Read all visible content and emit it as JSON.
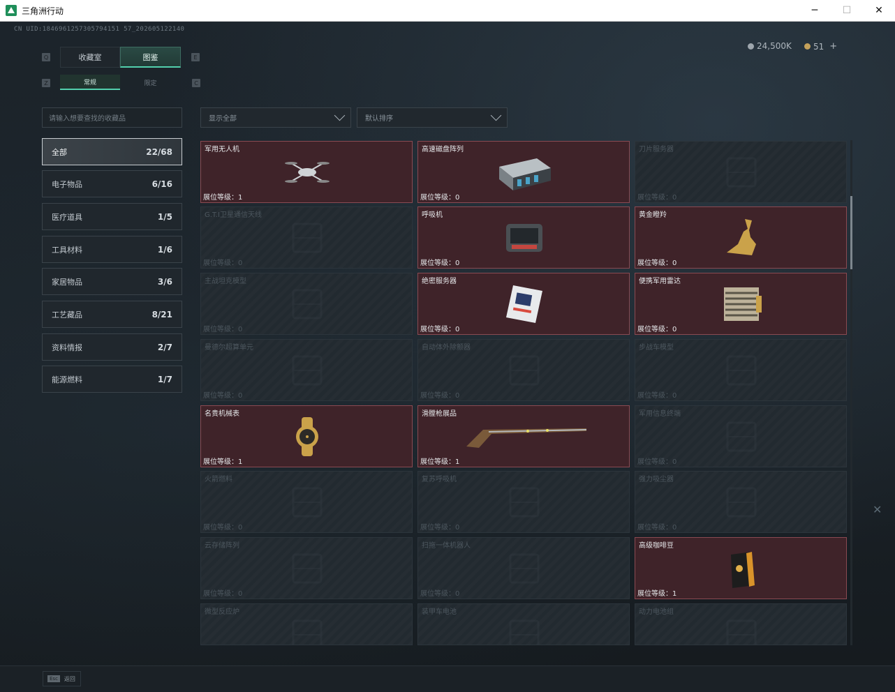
{
  "window": {
    "title": "三角洲行动",
    "minimize": "─",
    "maximize": "☐",
    "close": "✕"
  },
  "header": {
    "uid": "CN UID:1846961257305794151 57_202605122140",
    "currency1": "24,500K",
    "currency2": "51",
    "plus": "+"
  },
  "tabs": {
    "main": [
      {
        "label": "收藏室"
      },
      {
        "label": "图鉴"
      }
    ],
    "sub": [
      {
        "label": "常规"
      },
      {
        "label": "限定"
      }
    ],
    "key_q": "Q",
    "key_e": "E",
    "key_z": "Z",
    "key_c": "C"
  },
  "search": {
    "placeholder": "请输入想要查找的收藏品"
  },
  "filters": {
    "show": "显示全部",
    "sort": "默认排序"
  },
  "categories": [
    {
      "label": "全部",
      "count": "22/68"
    },
    {
      "label": "电子物品",
      "count": "6/16"
    },
    {
      "label": "医疗道具",
      "count": "1/5"
    },
    {
      "label": "工具材料",
      "count": "1/6"
    },
    {
      "label": "家居物品",
      "count": "3/6"
    },
    {
      "label": "工艺藏品",
      "count": "8/21"
    },
    {
      "label": "资料情报",
      "count": "2/7"
    },
    {
      "label": "能源燃料",
      "count": "1/7"
    }
  ],
  "level_prefix": "展位等级：",
  "items": [
    {
      "name": "军用无人机",
      "level": "1",
      "owned": true,
      "icon": "drone-icon"
    },
    {
      "name": "高速磁盘阵列",
      "level": "0",
      "owned": true,
      "icon": "disk-array-icon"
    },
    {
      "name": "刀片服务器",
      "level": "0",
      "owned": false,
      "icon": "blade-server-icon"
    },
    {
      "name": "G.T.I卫星通信天线",
      "level": "0",
      "owned": false,
      "icon": "satellite-antenna-icon"
    },
    {
      "name": "呼吸机",
      "level": "0",
      "owned": true,
      "icon": "ventilator-icon"
    },
    {
      "name": "黄金瞪羚",
      "level": "0",
      "owned": true,
      "icon": "gold-gazelle-icon"
    },
    {
      "name": "主战坦克模型",
      "level": "0",
      "owned": false,
      "icon": "tank-model-icon"
    },
    {
      "name": "绝密服务器",
      "level": "0",
      "owned": true,
      "icon": "secret-server-icon"
    },
    {
      "name": "便携军用雷达",
      "level": "0",
      "owned": true,
      "icon": "radar-icon"
    },
    {
      "name": "曼德尔超算单元",
      "level": "0",
      "owned": false,
      "icon": "supercomputer-icon"
    },
    {
      "name": "自动体外除颤器",
      "level": "0",
      "owned": false,
      "icon": "defibrillator-icon"
    },
    {
      "name": "步战车模型",
      "level": "0",
      "owned": false,
      "icon": "ifv-model-icon"
    },
    {
      "name": "名贵机械表",
      "level": "1",
      "owned": true,
      "icon": "watch-icon"
    },
    {
      "name": "滑膛枪展品",
      "level": "1",
      "owned": true,
      "icon": "musket-icon"
    },
    {
      "name": "军用信息终端",
      "level": "0",
      "owned": false,
      "icon": "terminal-icon"
    },
    {
      "name": "火箭燃料",
      "level": "0",
      "owned": false,
      "icon": "rocket-fuel-icon"
    },
    {
      "name": "复苏呼吸机",
      "level": "0",
      "owned": false,
      "icon": "resuscitator-icon"
    },
    {
      "name": "强力吸尘器",
      "level": "0",
      "owned": false,
      "icon": "vacuum-icon"
    },
    {
      "name": "云存储阵列",
      "level": "0",
      "owned": false,
      "icon": "cloud-storage-icon"
    },
    {
      "name": "扫拖一体机器人",
      "level": "0",
      "owned": false,
      "icon": "robot-vacuum-icon"
    },
    {
      "name": "高级咖啡豆",
      "level": "1",
      "owned": true,
      "icon": "coffee-bag-icon"
    },
    {
      "name": "微型反应炉",
      "level": "",
      "owned": false,
      "icon": "reactor-icon"
    },
    {
      "name": "装甲车电池",
      "level": "",
      "owned": false,
      "icon": "battery-icon"
    },
    {
      "name": "动力电池组",
      "level": "",
      "owned": false,
      "icon": "power-cell-icon"
    }
  ],
  "footer": {
    "key": "Esc",
    "label": "返回"
  }
}
